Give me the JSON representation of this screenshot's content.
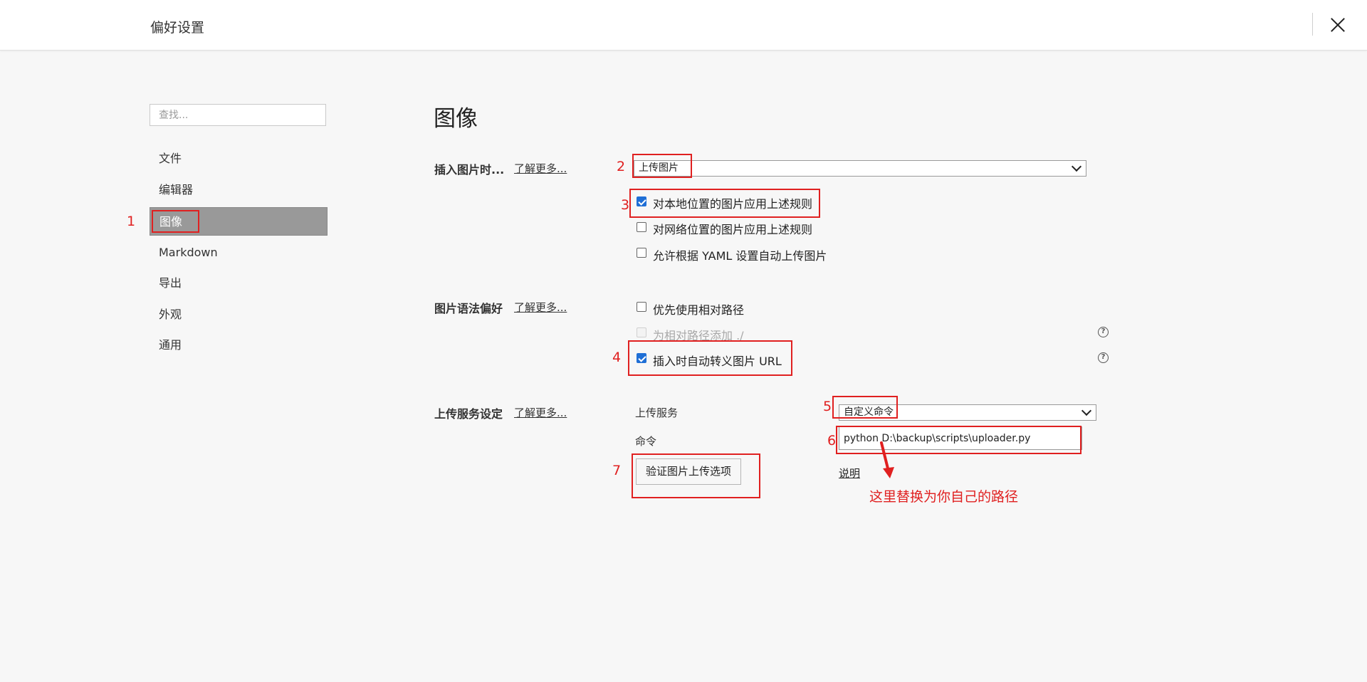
{
  "window": {
    "title": "偏好设置",
    "close_icon": "close-icon"
  },
  "sidebar": {
    "search_placeholder": "查找...",
    "items": [
      {
        "label": "文件"
      },
      {
        "label": "编辑器"
      },
      {
        "label": "图像",
        "active": true
      },
      {
        "label": "Markdown"
      },
      {
        "label": "导出"
      },
      {
        "label": "外观"
      },
      {
        "label": "通用"
      }
    ]
  },
  "main": {
    "title": "图像",
    "insert": {
      "label": "插入图片时...",
      "learn_more": "了解更多...",
      "select_value": "上传图片",
      "options": [
        {
          "label": "对本地位置的图片应用上述规则",
          "checked": true
        },
        {
          "label": "对网络位置的图片应用上述规则",
          "checked": false
        },
        {
          "label": "允许根据 YAML 设置自动上传图片",
          "checked": false
        }
      ]
    },
    "syntax": {
      "label": "图片语法偏好",
      "learn_more": "了解更多...",
      "options": [
        {
          "label": "优先使用相对路径",
          "checked": false
        },
        {
          "label": "为相对路径添加 ./",
          "checked": false,
          "disabled": true
        },
        {
          "label": "插入时自动转义图片 URL",
          "checked": true
        }
      ]
    },
    "upload": {
      "label": "上传服务设定",
      "learn_more": "了解更多...",
      "service_label": "上传服务",
      "service_value": "自定义命令",
      "command_label": "命令",
      "command_value": "python D:\\backup\\scripts\\uploader.py",
      "verify_button": "验证图片上传选项",
      "explain_link": "说明"
    }
  },
  "annotations": {
    "color": "#e02020",
    "numbers": [
      "1",
      "2",
      "3",
      "4",
      "5",
      "6",
      "7"
    ],
    "note": "这里替换为你自己的路径"
  }
}
